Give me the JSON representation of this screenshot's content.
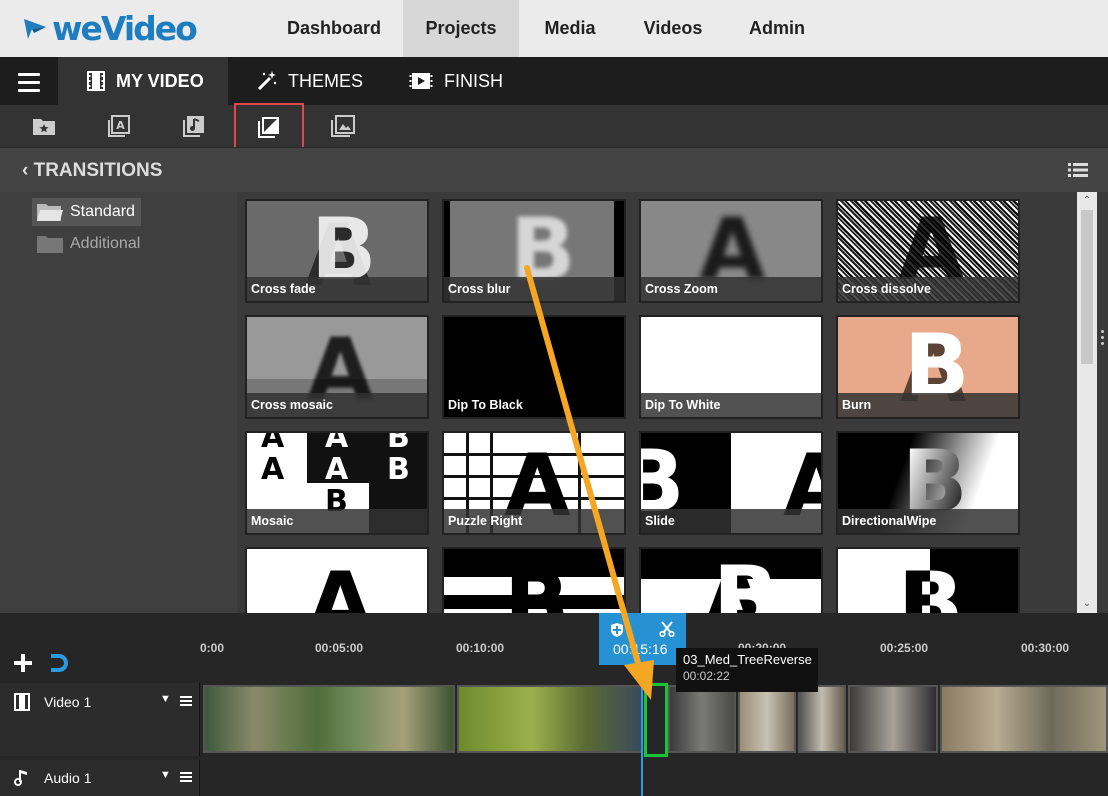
{
  "app": {
    "logo_text": "weVideo",
    "logo_icon": "wevideo-logo-icon"
  },
  "topnav": {
    "items": [
      {
        "label": "Dashboard",
        "active": false
      },
      {
        "label": "Projects",
        "active": true
      },
      {
        "label": "Media",
        "active": false
      },
      {
        "label": "Videos",
        "active": false
      },
      {
        "label": "Admin",
        "active": false
      }
    ]
  },
  "editor_tabs": {
    "menu_icon": "hamburger-icon",
    "items": [
      {
        "label": "MY VIDEO",
        "icon": "film-icon",
        "active": true
      },
      {
        "label": "THEMES",
        "icon": "magic-wand-icon",
        "active": false
      },
      {
        "label": "FINISH",
        "icon": "finish-film-icon",
        "active": false
      }
    ]
  },
  "toolbar": {
    "tools": [
      {
        "name": "media-folder-star-icon"
      },
      {
        "name": "text-title-icon"
      },
      {
        "name": "music-icon"
      },
      {
        "name": "transitions-icon",
        "selected": true
      },
      {
        "name": "image-gallery-icon"
      }
    ],
    "highlight_color": "#e04848"
  },
  "panel": {
    "title": "TRANSITIONS",
    "back_icon": "chevron-left-icon",
    "view_icon": "list-view-icon"
  },
  "folders": [
    {
      "label": "Standard",
      "selected": true
    },
    {
      "label": "Additional",
      "selected": false
    }
  ],
  "transitions": [
    {
      "label": "Cross fade"
    },
    {
      "label": "Cross blur"
    },
    {
      "label": "Cross Zoom"
    },
    {
      "label": "Cross dissolve"
    },
    {
      "label": "Cross mosaic"
    },
    {
      "label": "Dip To Black"
    },
    {
      "label": "Dip To White"
    },
    {
      "label": "Burn"
    },
    {
      "label": "Mosaic"
    },
    {
      "label": "Puzzle Right"
    },
    {
      "label": "Slide"
    },
    {
      "label": "DirectionalWipe"
    },
    {
      "label": ""
    },
    {
      "label": ""
    },
    {
      "label": ""
    },
    {
      "label": ""
    }
  ],
  "timeline": {
    "add_icon": "plus-icon",
    "magnet_icon": "magnet-icon",
    "ruler": [
      "0:00",
      "00:05:00",
      "00:10:00",
      "00:15:16",
      "00:20:00",
      "00:25:00",
      "00:30:00"
    ],
    "playhead": {
      "time": "00:15:16",
      "shield_icon": "shield-plus-icon",
      "scissors_icon": "scissors-icon",
      "color": "#2692d4"
    },
    "tooltip": {
      "clip_name": "03_Med_TreeReverse",
      "duration": "00:02:22"
    },
    "tracks": [
      {
        "name": "Video 1",
        "icon": "film-icon"
      },
      {
        "name": "Audio 1",
        "icon": "music-note-icon"
      }
    ],
    "selection_color": "#19c43a",
    "annotation_arrow_color": "#f5a623"
  }
}
